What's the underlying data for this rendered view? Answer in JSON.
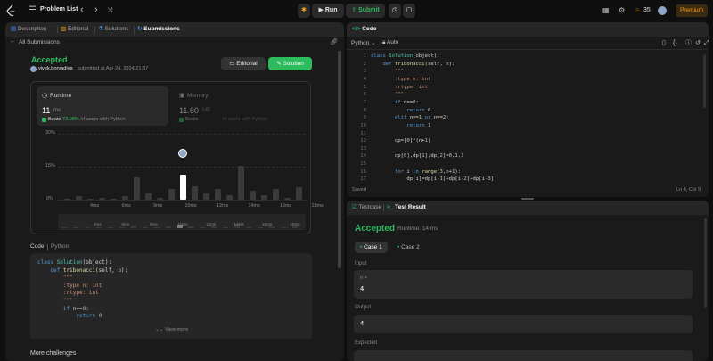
{
  "topbar": {
    "problem_list": "Problem List",
    "run_label": "Run",
    "submit_label": "Submit",
    "streak_count": "35",
    "premium_label": "Premium"
  },
  "left_tabs": [
    {
      "label": "Description",
      "icon": "description-icon"
    },
    {
      "label": "Editorial",
      "icon": "editorial-icon"
    },
    {
      "label": "Solutions",
      "icon": "solutions-icon"
    },
    {
      "label": "Submissions",
      "icon": "submissions-icon"
    }
  ],
  "submission": {
    "back_label": "All Submissions",
    "status": "Accepted",
    "user": "vivek.borvadiya",
    "submitted": "submitted at Apr 24, 2024 21:37",
    "editorial_button": "Editorial",
    "solution_button": "Solution"
  },
  "runtime": {
    "label": "Runtime",
    "value": "11",
    "unit": "ms",
    "beats_prefix": "Beats",
    "beats_pct": "73.08%",
    "beats_suffix": "of users with Python"
  },
  "memory": {
    "label": "Memory",
    "value": "11.60",
    "unit": "MB",
    "beats_prefix": "Beats",
    "beats_suffix": "of users with Python"
  },
  "chart_data": {
    "type": "bar",
    "y_ticks": [
      "30%",
      "15%",
      "0%"
    ],
    "ylim": [
      0,
      30
    ],
    "x_tick_labels": [
      "4ms",
      "6ms",
      "9ms",
      "10ms",
      "12ms",
      "14ms",
      "16ms",
      "18ms"
    ],
    "values": [
      0.5,
      1.5,
      0.5,
      1.0,
      0.5,
      1.5,
      10.0,
      3.0,
      1.0,
      5.0,
      11.5,
      6.0,
      3.0,
      5.0,
      2.0,
      15.5,
      4.0,
      2.0,
      5.0,
      1.0,
      5.5
    ],
    "highlight_index": 10,
    "mini_tick_labels": [
      "4ms",
      "6ms",
      "9ms",
      "10ms",
      "12ms",
      "14ms",
      "16ms",
      "18ms"
    ]
  },
  "code_view": {
    "label": "Code",
    "language": "Python",
    "view_more": "View more",
    "lines": [
      [
        [
          "kw",
          "class "
        ],
        [
          "cls",
          "Solution"
        ],
        [
          "txt",
          "(object):"
        ]
      ],
      [
        [
          "kw",
          "    def "
        ],
        [
          "fn",
          "tribonacci"
        ],
        [
          "txt",
          "(self, n):"
        ]
      ],
      [
        [
          "str",
          "        \"\"\""
        ]
      ],
      [
        [
          "str",
          "        :type n: int"
        ]
      ],
      [
        [
          "str",
          "        :rtype: int"
        ]
      ],
      [
        [
          "str",
          "        \"\"\""
        ]
      ],
      [
        [
          "kw",
          "        if "
        ],
        [
          "txt",
          "n=="
        ],
        [
          "num",
          "0"
        ],
        [
          "txt",
          ":"
        ]
      ],
      [
        [
          "kw",
          "            return "
        ],
        [
          "num",
          "0"
        ]
      ]
    ]
  },
  "more_challenges": "More challenges",
  "editor": {
    "title": "Code",
    "language": "Python",
    "auto": "Auto",
    "saved": "Saved",
    "cursor": "Ln 4, Col 9",
    "lines": [
      {
        "n": "1",
        "tokens": [
          [
            "kw",
            "class "
          ],
          [
            "cls",
            "Solution"
          ],
          [
            "txt",
            "(object):"
          ]
        ]
      },
      {
        "n": "2",
        "tokens": [
          [
            "kw",
            "    def "
          ],
          [
            "fn",
            "tribonacci"
          ],
          [
            "txt",
            "(self, n):"
          ]
        ]
      },
      {
        "n": "3",
        "tokens": [
          [
            "str",
            "        \"\"\""
          ]
        ]
      },
      {
        "n": "4",
        "tokens": [
          [
            "str",
            "        :type n: int"
          ]
        ]
      },
      {
        "n": "5",
        "tokens": [
          [
            "str",
            "        :rtype: int"
          ]
        ]
      },
      {
        "n": "6",
        "tokens": [
          [
            "str",
            "        \"\"\""
          ]
        ]
      },
      {
        "n": "7",
        "tokens": [
          [
            "kw",
            "        if "
          ],
          [
            "txt",
            "n=="
          ],
          [
            "num",
            "0"
          ],
          [
            "txt",
            ":"
          ]
        ]
      },
      {
        "n": "8",
        "tokens": [
          [
            "kw",
            "            return "
          ],
          [
            "num",
            "0"
          ]
        ]
      },
      {
        "n": "9",
        "tokens": [
          [
            "kw",
            "        elif "
          ],
          [
            "txt",
            "n=="
          ],
          [
            "num",
            "1"
          ],
          [
            "kw",
            " or "
          ],
          [
            "txt",
            "n=="
          ],
          [
            "num",
            "2"
          ],
          [
            "txt",
            ":"
          ]
        ]
      },
      {
        "n": "10",
        "tokens": [
          [
            "kw",
            "            return "
          ],
          [
            "num",
            "1"
          ]
        ]
      },
      {
        "n": "11",
        "tokens": [
          [
            "txt",
            ""
          ]
        ]
      },
      {
        "n": "12",
        "tokens": [
          [
            "txt",
            "        dp=["
          ],
          [
            "num",
            "0"
          ],
          [
            "txt",
            "]*(n+"
          ],
          [
            "num",
            "1"
          ],
          [
            "txt",
            ")"
          ]
        ]
      },
      {
        "n": "13",
        "tokens": [
          [
            "txt",
            ""
          ]
        ]
      },
      {
        "n": "14",
        "tokens": [
          [
            "txt",
            "        dp["
          ],
          [
            "num",
            "0"
          ],
          [
            "txt",
            "],dp["
          ],
          [
            "num",
            "1"
          ],
          [
            "txt",
            "],dp["
          ],
          [
            "num",
            "2"
          ],
          [
            "txt",
            "]="
          ],
          [
            "num",
            "0"
          ],
          [
            "txt",
            ","
          ],
          [
            "num",
            "1"
          ],
          [
            "txt",
            ","
          ],
          [
            "num",
            "1"
          ]
        ]
      },
      {
        "n": "15",
        "tokens": [
          [
            "txt",
            ""
          ]
        ]
      },
      {
        "n": "16",
        "tokens": [
          [
            "kw",
            "        for "
          ],
          [
            "txt",
            "i "
          ],
          [
            "kw",
            "in "
          ],
          [
            "fn",
            "range"
          ],
          [
            "txt",
            "("
          ],
          [
            "num",
            "3"
          ],
          [
            "txt",
            ",n+"
          ],
          [
            "num",
            "1"
          ],
          [
            "txt",
            "):"
          ]
        ]
      },
      {
        "n": "17",
        "tokens": [
          [
            "txt",
            "            dp[i]=dp[i-"
          ],
          [
            "num",
            "1"
          ],
          [
            "txt",
            "]+dp[i-"
          ],
          [
            "num",
            "2"
          ],
          [
            "txt",
            "]+dp[i-"
          ],
          [
            "num",
            "3"
          ],
          [
            "txt",
            "]"
          ]
        ]
      }
    ]
  },
  "result": {
    "tab_testcase": "Testcase",
    "tab_result": "Test Result",
    "status": "Accepted",
    "runtime": "Runtime: 14 ms",
    "case1": "Case 1",
    "case2": "Case 2",
    "input_label": "Input",
    "input_var": "n =",
    "input_value": "4",
    "output_label": "Output",
    "output_value": "4",
    "expected_label": "Expected"
  }
}
